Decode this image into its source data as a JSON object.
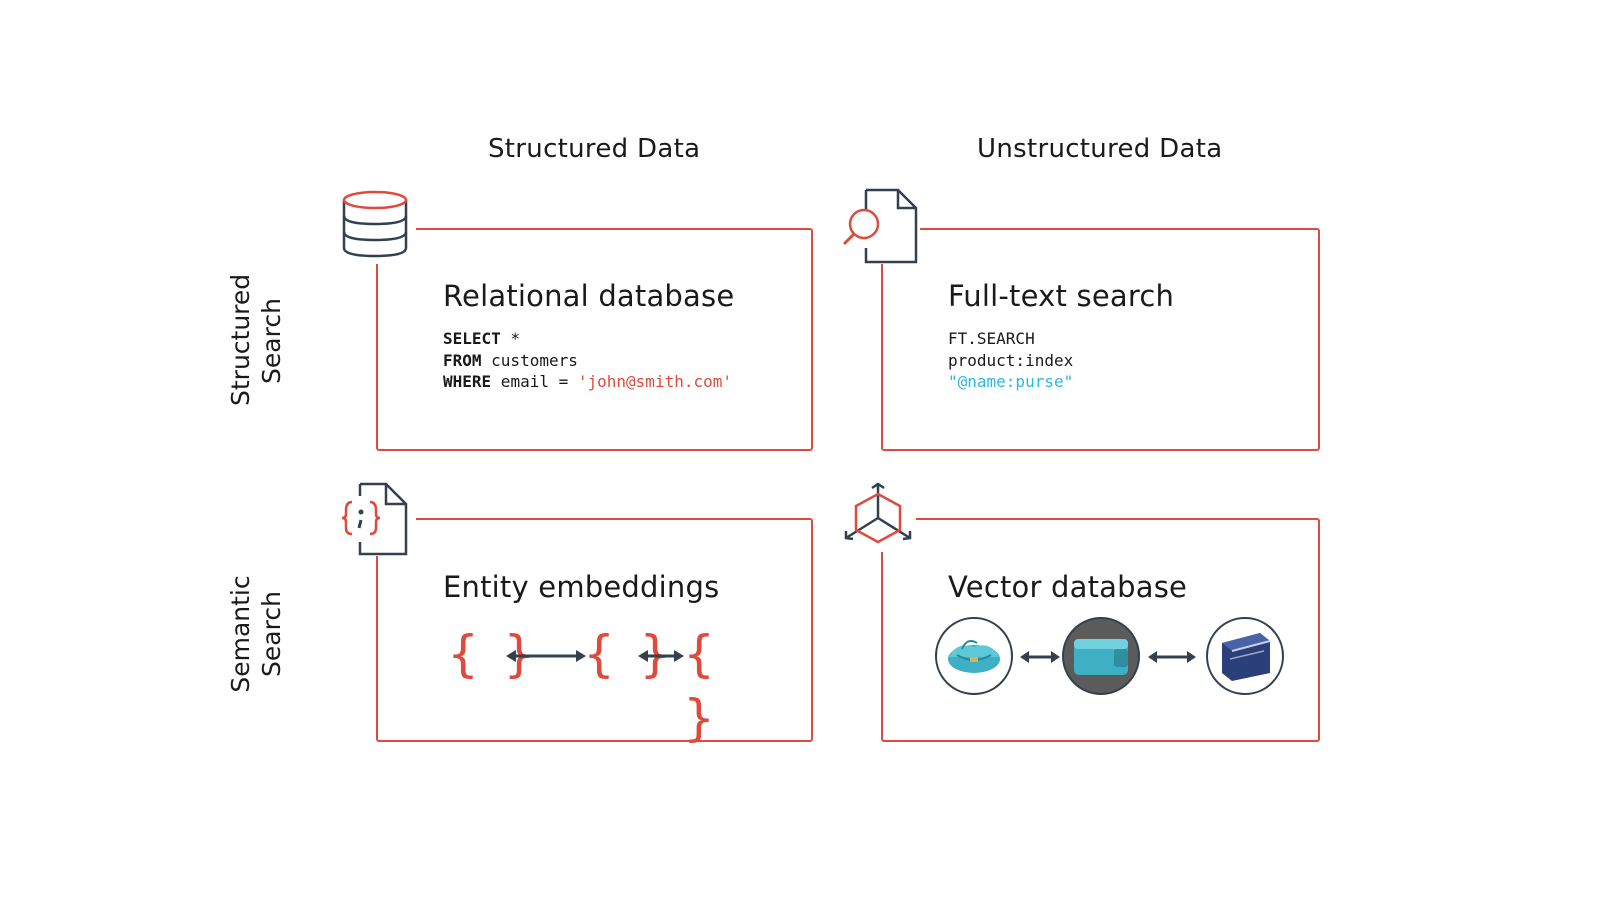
{
  "columns": {
    "structured_data": "Structured Data",
    "unstructured_data": "Unstructured Data"
  },
  "rows": {
    "structured_search": [
      "Structured",
      "Search"
    ],
    "semantic_search": [
      "Semantic",
      "Search"
    ]
  },
  "cards": {
    "relational": {
      "title": "Relational database",
      "code": {
        "line1_kw": "SELECT",
        "line1_rest": " *",
        "line2_kw": "FROM",
        "line2_rest": " customers",
        "line3_kw": "WHERE",
        "line3_rest": " email = ",
        "line3_str": "'john@smith.com'"
      }
    },
    "fulltext": {
      "title": "Full-text search",
      "code": {
        "line1": "FT.SEARCH",
        "line2": "product:index",
        "line3": "\"@name:purse\""
      }
    },
    "entity": {
      "title": "Entity embeddings",
      "braces": [
        "{ }",
        "{ }",
        "{ }"
      ]
    },
    "vector": {
      "title": "Vector database",
      "items": [
        "teal-pouch",
        "teal-wallet",
        "navy-wallet"
      ]
    }
  },
  "icons": [
    "database-icon",
    "document-search-icon",
    "json-document-icon",
    "cube-3d-icon"
  ],
  "colors": {
    "accent_red": "#dd4b3f",
    "icon_dark": "#33414f",
    "highlight_blue": "#2bb7e8",
    "teal": "#3fb0c3",
    "navy": "#2b3f7a"
  }
}
